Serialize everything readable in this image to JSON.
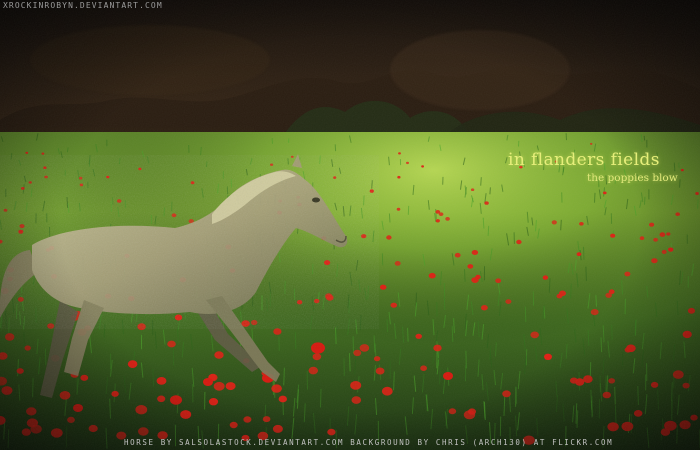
{
  "artwork": {
    "watermark": "xrockinrobyn.deviantart.com",
    "title": "in flanders fields",
    "subtitle": "the poppies blow",
    "credits": "horse by salsolastock.deviantart.com    background by chris (arch130) at flickr.com"
  },
  "palette": {
    "sky_dark": "#1a130d",
    "forest": "#3c2a18",
    "meadow_light": "#86b42e",
    "meadow_dark": "#1d3512",
    "poppy": "#e01f14",
    "horse_coat": "#b7ad88",
    "title_color": "#e6ee7a"
  }
}
